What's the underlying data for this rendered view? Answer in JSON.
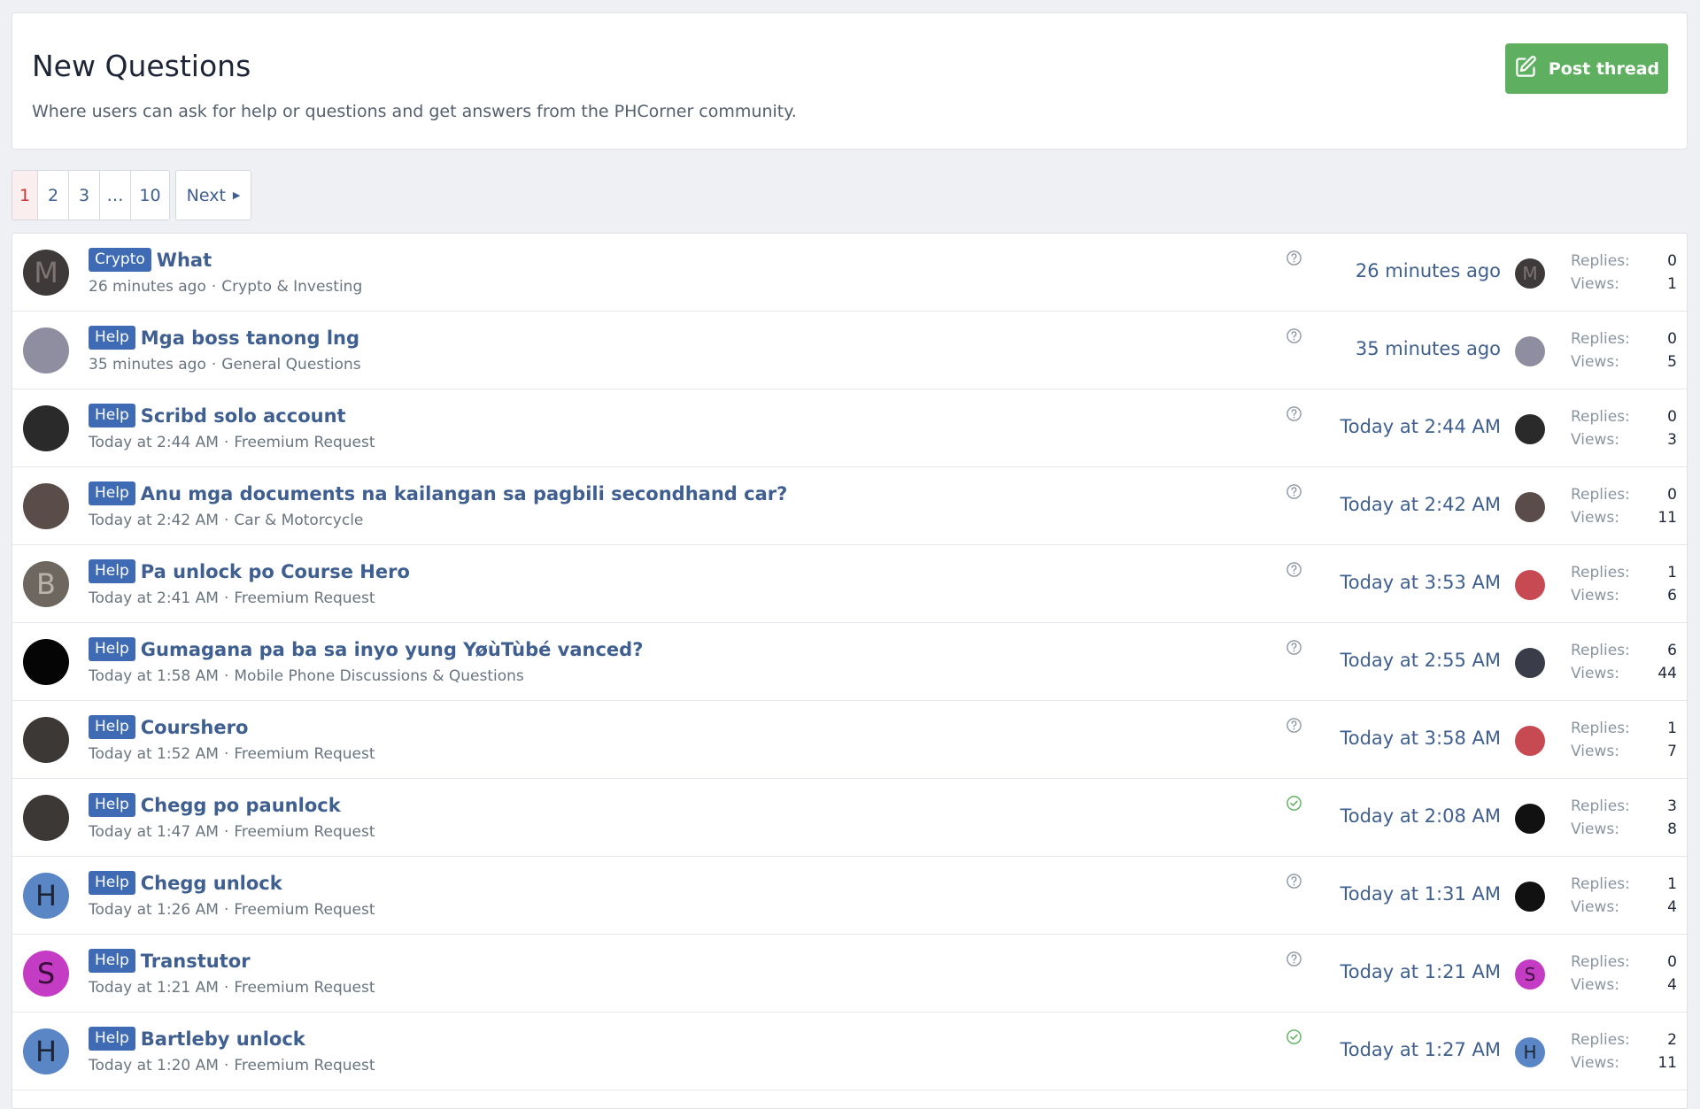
{
  "header": {
    "title": "New Questions",
    "description": "Where users can ask for help or questions and get answers from the PHCorner community.",
    "post_button": "Post thread"
  },
  "pagination": {
    "pages": [
      "1",
      "2",
      "3",
      "…",
      "10"
    ],
    "current": "1",
    "next_label": "Next"
  },
  "labels": {
    "replies": "Replies:",
    "views": "Views:"
  },
  "colors": {
    "prefix": "#3e6bb4",
    "link": "#3e5f8f",
    "post_button": "#5eb060",
    "solved": "#5eb060",
    "question": "#8a94a0"
  },
  "threads": [
    {
      "prefix": "Crypto",
      "title": "What",
      "started": "26 minutes ago",
      "forum": "Crypto & Investing",
      "status_icon": "question-icon",
      "last_post": "26 minutes ago",
      "replies": "0",
      "views": "1",
      "avatar_letter": "M",
      "avatar_color": "#3e3a3a",
      "avatar_text_color": "#7d7474",
      "mini_avatar_letter": "M",
      "mini_avatar_color": "#3e3a3a"
    },
    {
      "prefix": "Help",
      "title": "Mga boss tanong lng",
      "started": "35 minutes ago",
      "forum": "General Questions",
      "status_icon": "question-icon",
      "last_post": "35 minutes ago",
      "replies": "0",
      "views": "5",
      "avatar_letter": "",
      "avatar_color": "#8f8ea0",
      "avatar_text_color": "#fff",
      "mini_avatar_letter": "",
      "mini_avatar_color": "#8f8ea0"
    },
    {
      "prefix": "Help",
      "title": "Scribd solo account",
      "started": "Today at 2:44 AM",
      "forum": "Freemium Request",
      "status_icon": "question-icon",
      "last_post": "Today at 2:44 AM",
      "replies": "0",
      "views": "3",
      "avatar_letter": "",
      "avatar_color": "#2a2a2a",
      "avatar_text_color": "#fff",
      "mini_avatar_letter": "",
      "mini_avatar_color": "#2a2a2a"
    },
    {
      "prefix": "Help",
      "title": "Anu mga documents na kailangan sa pagbili secondhand car?",
      "started": "Today at 2:42 AM",
      "forum": "Car & Motorcycle",
      "status_icon": "question-icon",
      "last_post": "Today at 2:42 AM",
      "replies": "0",
      "views": "11",
      "avatar_letter": "",
      "avatar_color": "#5a4c48",
      "avatar_text_color": "#fff",
      "mini_avatar_letter": "",
      "mini_avatar_color": "#5a4c48"
    },
    {
      "prefix": "Help",
      "title": "Pa unlock po Course Hero",
      "started": "Today at 2:41 AM",
      "forum": "Freemium Request",
      "status_icon": "question-icon",
      "last_post": "Today at 3:53 AM",
      "replies": "1",
      "views": "6",
      "avatar_letter": "B",
      "avatar_color": "#6e675f",
      "avatar_text_color": "#b9b3ab",
      "mini_avatar_letter": "",
      "mini_avatar_color": "#c74a52"
    },
    {
      "prefix": "Help",
      "title": "Gumagana pa ba sa inyo yung YøùTùbé vanced?",
      "started": "Today at 1:58 AM",
      "forum": "Mobile Phone Discussions & Questions",
      "status_icon": "question-icon",
      "last_post": "Today at 2:55 AM",
      "replies": "6",
      "views": "44",
      "avatar_letter": "",
      "avatar_color": "#050505",
      "avatar_text_color": "#fff",
      "mini_avatar_letter": "",
      "mini_avatar_color": "#3a3c4a"
    },
    {
      "prefix": "Help",
      "title": "Courshero",
      "started": "Today at 1:52 AM",
      "forum": "Freemium Request",
      "status_icon": "question-icon",
      "last_post": "Today at 3:58 AM",
      "replies": "1",
      "views": "7",
      "avatar_letter": "",
      "avatar_color": "#3b3836",
      "avatar_text_color": "#fff",
      "mini_avatar_letter": "",
      "mini_avatar_color": "#c74a52"
    },
    {
      "prefix": "Help",
      "title": "Chegg po paunlock",
      "started": "Today at 1:47 AM",
      "forum": "Freemium Request",
      "status_icon": "solved-icon",
      "last_post": "Today at 2:08 AM",
      "replies": "3",
      "views": "8",
      "avatar_letter": "",
      "avatar_color": "#3b3836",
      "avatar_text_color": "#fff",
      "mini_avatar_letter": "",
      "mini_avatar_color": "#111111"
    },
    {
      "prefix": "Help",
      "title": "Chegg unlock",
      "started": "Today at 1:26 AM",
      "forum": "Freemium Request",
      "status_icon": "question-icon",
      "last_post": "Today at 1:31 AM",
      "replies": "1",
      "views": "4",
      "avatar_letter": "H",
      "avatar_color": "#5a86c6",
      "avatar_text_color": "#1d2536",
      "mini_avatar_letter": "",
      "mini_avatar_color": "#111111"
    },
    {
      "prefix": "Help",
      "title": "Transtutor",
      "started": "Today at 1:21 AM",
      "forum": "Freemium Request",
      "status_icon": "question-icon",
      "last_post": "Today at 1:21 AM",
      "replies": "0",
      "views": "4",
      "avatar_letter": "S",
      "avatar_color": "#c43bc4",
      "avatar_text_color": "#3a0d3a",
      "mini_avatar_letter": "S",
      "mini_avatar_color": "#c43bc4"
    },
    {
      "prefix": "Help",
      "title": "Bartleby unlock",
      "started": "Today at 1:20 AM",
      "forum": "Freemium Request",
      "status_icon": "solved-icon",
      "last_post": "Today at 1:27 AM",
      "replies": "2",
      "views": "11",
      "avatar_letter": "H",
      "avatar_color": "#5a86c6",
      "avatar_text_color": "#1d2536",
      "mini_avatar_letter": "H",
      "mini_avatar_color": "#5a86c6"
    }
  ]
}
